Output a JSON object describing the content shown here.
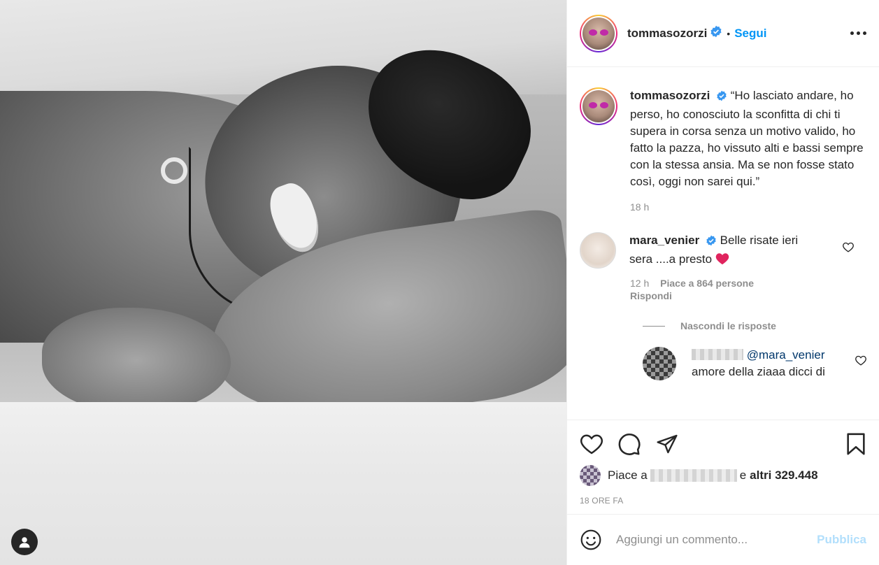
{
  "post": {
    "author": "tommasozorzi",
    "follow_label": "Segui",
    "separator": "•",
    "caption": "“Ho lasciato andare, ho perso, ho conosciuto la sconfitta di chi ti supera in corsa senza un motivo valido, ho fatto la pazza, ho vissuto alti e bassi sempre con la stessa ansia. Ma se non fosse stato così, oggi non sarei qui.”",
    "caption_time": "18 h"
  },
  "comment": {
    "author": "mara_venier",
    "text": "Belle risate ieri sera ....a presto",
    "emoji": "❤️",
    "time": "12 h",
    "likes": "Piace a 864 persone",
    "reply_label": "Rispondi"
  },
  "hide_replies_label": "Nascondi le risposte",
  "reply": {
    "mention": "@mara_venier",
    "text": "amore della ziaaa dicci di"
  },
  "likes_bar": {
    "prefix": "Piace a",
    "conjunction": "e",
    "others": "altri 329.448",
    "timestamp": "18 ORE FA"
  },
  "composer": {
    "placeholder": "Aggiungi un commento...",
    "publish_label": "Pubblica"
  },
  "colors": {
    "accent": "#0095f6",
    "publish_disabled": "#b2dffc",
    "verified": "#3897f0",
    "heart_emoji": "#e0245e"
  },
  "icons": {
    "options": "more-horizontal-icon",
    "like": "heart-icon",
    "comment": "comment-bubble-icon",
    "share": "paper-plane-icon",
    "save": "bookmark-icon",
    "emoji": "smiley-icon",
    "tag": "user-tag-icon"
  }
}
